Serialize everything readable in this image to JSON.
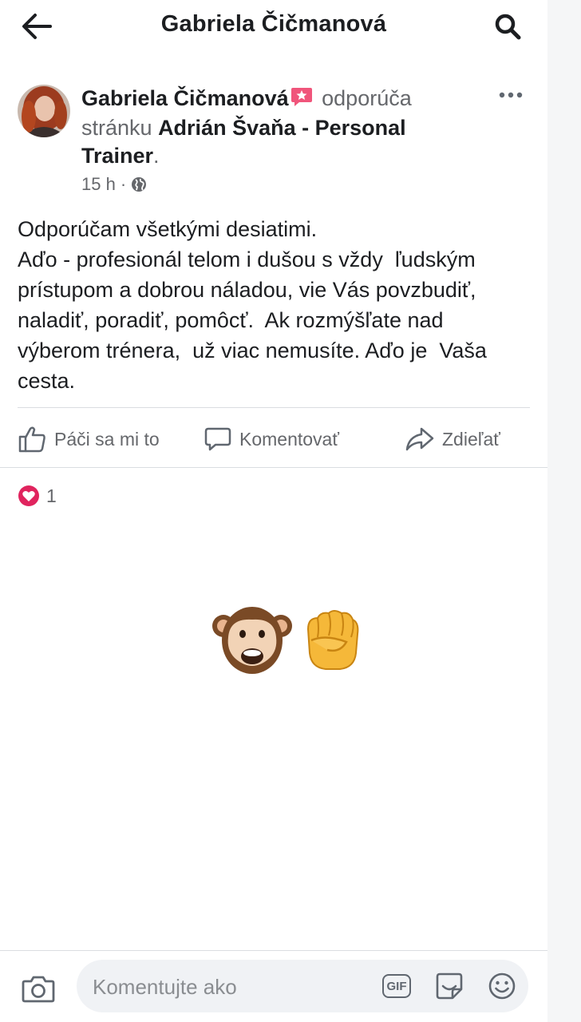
{
  "header": {
    "title": "Gabriela Čičmanová"
  },
  "post": {
    "author": "Gabriela Čičmanová",
    "verb": "odporúča",
    "object_prefix": "stránku",
    "page_name": "Adrián Švaňa - Personal Trainer",
    "period": ".",
    "time": "15 h",
    "separator": "·",
    "privacy_icon": "globe-icon",
    "body_lines": [
      "Odporúčam všetkými desiatimi.",
      "Aďo - profesionál telom i dušou s vždy  ľudským",
      "prístupom a dobrou náladou, vie Vás povzbudiť,",
      "naladiť, poradiť, pomôcť.  Ak rozmýšľate nad",
      "výberom trénera,  už viac nemusíte. Aďo je  Vaša",
      "cesta."
    ]
  },
  "actions": {
    "like_label": "Páči sa mi to",
    "comment_label": "Komentovať",
    "share_label": "Zdieľať"
  },
  "reactions": {
    "type": "love",
    "count": "1",
    "color": "#e0245e"
  },
  "comment_emojis": [
    "monkey-face-icon",
    "raised-fist-icon"
  ],
  "composer": {
    "placeholder": "Komentujte ako",
    "icons": [
      "camera-icon",
      "gif-icon",
      "sticker-icon",
      "emoji-icon"
    ]
  },
  "colors": {
    "recommend_badge": "#f0557b",
    "muted_text": "#65676b",
    "divider": "#dadde1"
  }
}
